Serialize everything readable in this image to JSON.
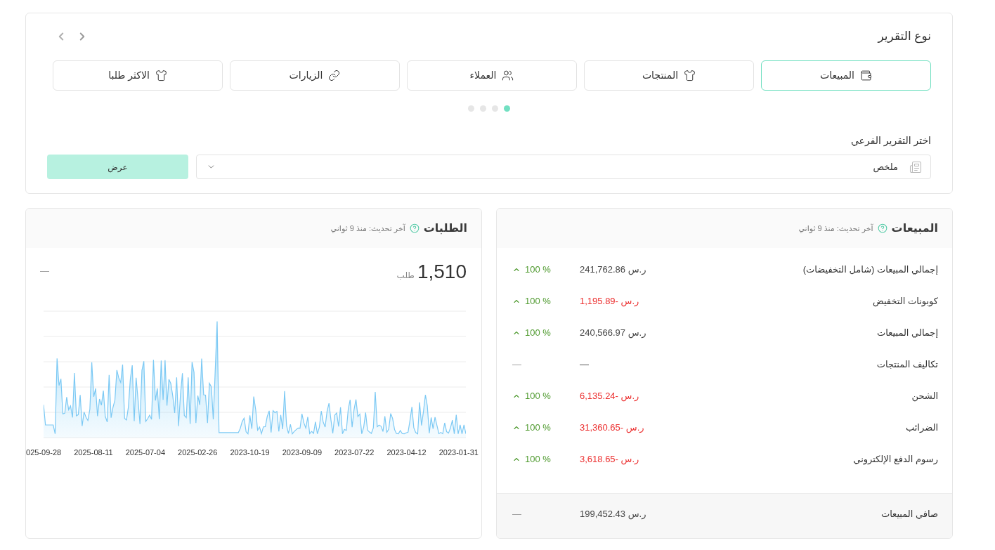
{
  "report_type": {
    "title": "نوع التقرير",
    "tabs": [
      {
        "label": "المبيعات",
        "kind": "wallet",
        "selected": true
      },
      {
        "label": "المنتجات",
        "kind": "shirt",
        "selected": false
      },
      {
        "label": "العملاء",
        "kind": "users",
        "selected": false
      },
      {
        "label": "الزيارات",
        "kind": "link",
        "selected": false
      },
      {
        "label": "الاكثر طلبا",
        "kind": "shirt",
        "selected": false
      }
    ],
    "pager_dots": [
      {
        "selected": true
      },
      {
        "selected": false
      },
      {
        "selected": false
      },
      {
        "selected": false
      }
    ]
  },
  "sub_report": {
    "label": "اختر التقرير الفرعي",
    "select": {
      "value": "ملخص"
    },
    "button": "عرض"
  },
  "orders": {
    "title": "الطلبات",
    "updated": "آخر تحديث: منذ 9 ثواني",
    "total": "1,510",
    "unit": "طلب",
    "change": "—",
    "x_labels": [
      "2023-01-31",
      "2023-04-12",
      "2023-07-22",
      "2023-09-09",
      "2023-10-19",
      "2025-02-26",
      "2025-07-04",
      "2025-08-11",
      "025-09-28"
    ]
  },
  "sales": {
    "title": "المبيعات",
    "updated": "آخر تحديث: منذ 9 ثواني",
    "rows": [
      {
        "kind": "rise",
        "label": "إجمالي المبيعات (شامل التخفيضات)",
        "value": "ر.س 241,762.86",
        "negative": false,
        "change": "100 %"
      },
      {
        "kind": "rise",
        "label": "كوبونات التخفيض",
        "value": "ر.س -1,195.89",
        "negative": true,
        "change": "100 %"
      },
      {
        "kind": "rise",
        "label": "إجمالي المبيعات",
        "value": "ر.س 240,566.97",
        "negative": false,
        "change": "100 %"
      },
      {
        "kind": "blank",
        "label": "تكاليف المنتجات",
        "value": "—",
        "negative": false,
        "change": "—"
      },
      {
        "kind": "rise",
        "label": "الشحن",
        "value": "ر.س -6,135.24",
        "negative": true,
        "change": "100 %"
      },
      {
        "kind": "rise",
        "label": "الضرائب",
        "value": "ر.س -31,360.65",
        "negative": true,
        "change": "100 %"
      },
      {
        "kind": "rise",
        "label": "رسوم الدفع الإلكتروني",
        "value": "ر.س -3,618.65",
        "negative": true,
        "change": "100 %"
      }
    ],
    "footer": {
      "label": "صافي المبيعات",
      "value": "ر.س 199,452.43",
      "change": "—"
    }
  }
}
